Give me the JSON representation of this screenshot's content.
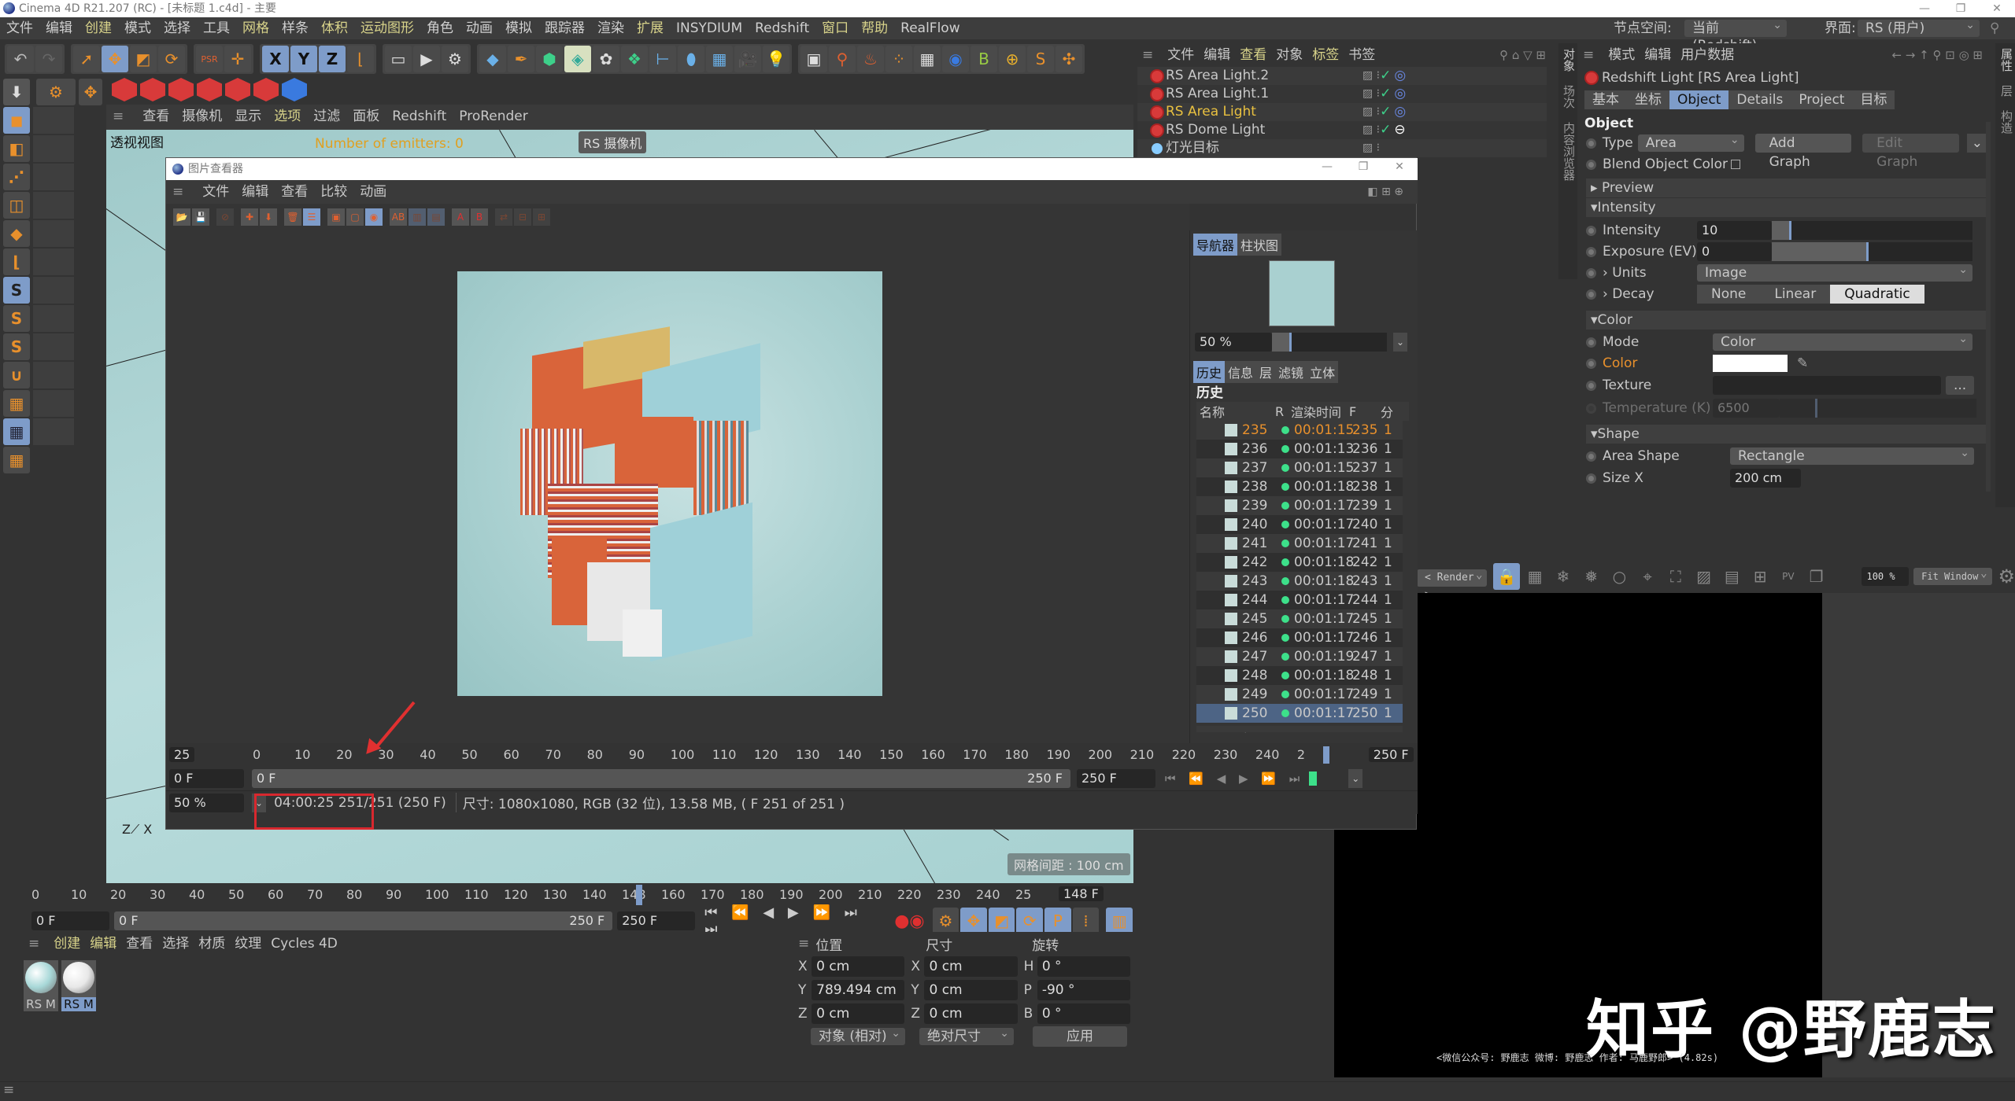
{
  "os_window": {
    "title": "Cinema 4D R21.207 (RC) - [未标题 1.c4d] - 主要",
    "minimize": "—",
    "maximize": "❐",
    "close": "✕"
  },
  "main_menu": {
    "items": [
      "文件",
      "编辑",
      "创建",
      "模式",
      "选择",
      "工具",
      "网格",
      "样条",
      "体积",
      "运动图形",
      "角色",
      "动画",
      "模拟",
      "跟踪器",
      "渲染",
      "扩展",
      "INSYDIUM",
      "Redshift",
      "窗口",
      "帮助",
      "RealFlow"
    ],
    "node_space_label": "节点空间:",
    "node_space_value": "当前 (Redshift)",
    "layout_label": "界面:",
    "layout_value": "RS (用户)"
  },
  "viewport": {
    "menu": [
      "查看",
      "摄像机",
      "显示",
      "选项",
      "过滤",
      "面板",
      "Redshift",
      "ProRender"
    ],
    "view_label": "透视视图",
    "emitters_text": "Number of emitters: 0",
    "camera_label": "RS 摄像机",
    "grid_spacing": "网格间距 : 100 cm"
  },
  "picture_viewer": {
    "title": "图片查看器",
    "menu": [
      "文件",
      "编辑",
      "查看",
      "比较",
      "动画"
    ],
    "nav_tabs": [
      "导航器",
      "柱状图"
    ],
    "nav_zoom": "50 %",
    "nav_zoom_fraction": 0.15,
    "info_tabs": [
      "历史",
      "信息",
      "层",
      "滤镜",
      "立体"
    ],
    "history_heading": "历史",
    "history_columns": [
      "名称",
      "R",
      "渲染时间",
      "F",
      "分"
    ],
    "history_rows": [
      {
        "name": "235 *",
        "time": "00:01:15",
        "frame": "235",
        "extra": "1",
        "active": true
      },
      {
        "name": "236 *",
        "time": "00:01:13",
        "frame": "236",
        "extra": "1"
      },
      {
        "name": "237 *",
        "time": "00:01:15",
        "frame": "237",
        "extra": "1"
      },
      {
        "name": "238 *",
        "time": "00:01:18",
        "frame": "238",
        "extra": "1"
      },
      {
        "name": "239 *",
        "time": "00:01:17",
        "frame": "239",
        "extra": "1"
      },
      {
        "name": "240 *",
        "time": "00:01:17",
        "frame": "240",
        "extra": "1"
      },
      {
        "name": "241 *",
        "time": "00:01:17",
        "frame": "241",
        "extra": "1"
      },
      {
        "name": "242 *",
        "time": "00:01:18",
        "frame": "242",
        "extra": "1"
      },
      {
        "name": "243 *",
        "time": "00:01:18",
        "frame": "243",
        "extra": "1"
      },
      {
        "name": "244 *",
        "time": "00:01:17",
        "frame": "244",
        "extra": "1"
      },
      {
        "name": "245 *",
        "time": "00:01:17",
        "frame": "245",
        "extra": "1"
      },
      {
        "name": "246 *",
        "time": "00:01:17",
        "frame": "246",
        "extra": "1"
      },
      {
        "name": "247 *",
        "time": "00:01:19",
        "frame": "247",
        "extra": "1"
      },
      {
        "name": "248 *",
        "time": "00:01:18",
        "frame": "248",
        "extra": "1"
      },
      {
        "name": "249 *",
        "time": "00:01:17",
        "frame": "249",
        "extra": "1"
      },
      {
        "name": "250 *",
        "time": "00:01:17",
        "frame": "250",
        "extra": "1",
        "selected": true
      }
    ],
    "fps": "25",
    "ruler_ticks": [
      "0",
      "10",
      "20",
      "30",
      "40",
      "50",
      "60",
      "70",
      "80",
      "90",
      "100",
      "110",
      "120",
      "130",
      "140",
      "150",
      "160",
      "170",
      "180",
      "190",
      "200",
      "210",
      "220",
      "230",
      "240",
      "2"
    ],
    "current_frame": "250 F",
    "range_start": "0 F",
    "range_start_inner": "0 F",
    "range_end_inner": "250 F",
    "range_end": "250 F",
    "zoom": "50 %",
    "status_time": "04:00:25 251/251 (250 F)",
    "status_info": "尺寸: 1080x1080, RGB (32 位), 13.58 MB,  ( F 251 of 251 )"
  },
  "object_manager": {
    "menu": [
      "文件",
      "编辑",
      "查看",
      "对象",
      "标签",
      "书签"
    ],
    "objects": [
      {
        "name": "RS Area Light.2",
        "type": "light"
      },
      {
        "name": "RS Area Light.1",
        "type": "light"
      },
      {
        "name": "RS Area Light",
        "type": "light",
        "selected": true
      },
      {
        "name": "RS Dome Light",
        "type": "light"
      },
      {
        "name": "灯光目标",
        "type": "target"
      }
    ],
    "side_tabs": [
      "对象",
      "场次",
      "内容浏览器"
    ]
  },
  "attributes": {
    "menu": [
      "模式",
      "编辑",
      "用户数据"
    ],
    "object_title": "Redshift Light [RS Area Light]",
    "tabs": [
      "基本",
      "坐标",
      "Object",
      "Details",
      "Project",
      "目标"
    ],
    "active_tab": "Object",
    "section_title": "Object",
    "type_label": "Type",
    "type_value": "Area",
    "add_graph": "Add Graph",
    "edit_graph": "Edit Graph",
    "blend_label": "Blend Object Color",
    "preview_section": "Preview",
    "intensity_section": "Intensity",
    "intensity_label": "Intensity",
    "intensity_value": "10",
    "exposure_label": "Exposure (EV)",
    "exposure_value": "0",
    "units_label": "Units",
    "units_value": "Image",
    "decay_label": "Decay",
    "decay_options": [
      "None",
      "Linear",
      "Quadratic"
    ],
    "decay_value": "Quadratic",
    "color_section": "Color",
    "mode_label": "Mode",
    "mode_value": "Color",
    "color_label": "Color",
    "color_value": "#ffffff",
    "texture_label": "Texture",
    "texture_button": "...",
    "temperature_label": "Temperature (K)",
    "temperature_value": "6500",
    "shape_section": "Shape",
    "area_shape_label": "Area Shape",
    "area_shape_value": "Rectangle",
    "size_x_label": "Size X",
    "size_x_value": "200 cm",
    "side_tabs": [
      "属性",
      "层",
      "构造"
    ]
  },
  "render_view": {
    "render_dropdown": "< Render >",
    "zoom_value": "100 %",
    "fit_value": "Fit Window",
    "watermark": "知乎 @野鹿志",
    "credit": "<微信公众号: 野鹿志  微博: 野鹿志  作者: 马鹿野郎> (4.82s)"
  },
  "timeline": {
    "ticks": [
      "0",
      "10",
      "20",
      "30",
      "40",
      "50",
      "60",
      "70",
      "80",
      "90",
      "100",
      "110",
      "120",
      "130",
      "140",
      "148",
      "160",
      "170",
      "180",
      "190",
      "200",
      "210",
      "220",
      "230",
      "240",
      "25"
    ],
    "current_frame": "148 F",
    "start": "0 F",
    "range_start": "0 F",
    "range_end": "250 F",
    "end": "250 F"
  },
  "material_manager": {
    "menu": [
      "创建",
      "编辑",
      "查看",
      "选择",
      "材质",
      "纹理",
      "Cycles 4D"
    ],
    "materials": [
      {
        "name": "RS M",
        "color": "#a8d8d8"
      },
      {
        "name": "RS M",
        "color": "#e8e8e8",
        "selected": true
      }
    ]
  },
  "coordinates": {
    "headers": [
      "位置",
      "尺寸",
      "旋转"
    ],
    "rows": [
      {
        "pos_axis": "X",
        "pos": "0 cm",
        "size_axis": "X",
        "size": "0 cm",
        "rot_axis": "H",
        "rot": "0 °"
      },
      {
        "pos_axis": "Y",
        "pos": "789.494 cm",
        "size_axis": "Y",
        "size": "0 cm",
        "rot_axis": "P",
        "rot": "-90 °"
      },
      {
        "pos_axis": "Z",
        "pos": "0 cm",
        "size_axis": "Z",
        "size": "0 cm",
        "rot_axis": "B",
        "rot": "0 °"
      }
    ],
    "mode_dropdown": "对象 (相对)",
    "size_dropdown": "绝对尺寸",
    "apply_button": "应用"
  },
  "colors": {
    "accent_blue": "#7e9cc9",
    "highlight_yellow": "#d8d38a",
    "active_orange": "#e8902c",
    "status_green": "#3de08a",
    "annotation_red": "#d8282e"
  }
}
